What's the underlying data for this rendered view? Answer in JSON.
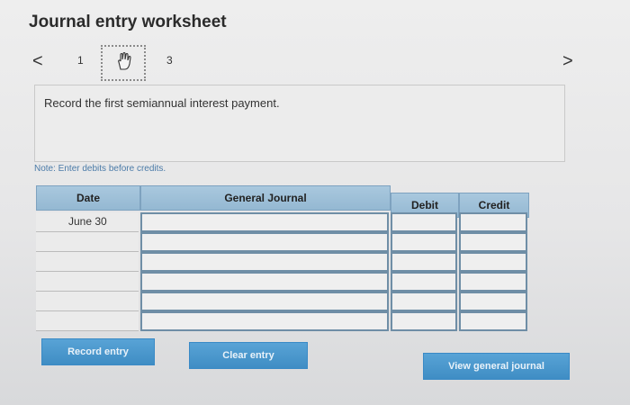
{
  "header": {
    "title": "Journal entry worksheet"
  },
  "nav": {
    "prev_icon": "<",
    "next_icon": ">",
    "steps": [
      "1",
      "",
      "3"
    ]
  },
  "prompt": {
    "text": "Record the first semiannual interest payment."
  },
  "note": {
    "text": "Note: Enter debits before credits."
  },
  "table": {
    "headers": {
      "date": "Date",
      "general_journal": "General Journal",
      "debit": "Debit",
      "credit": "Credit"
    },
    "rows": [
      {
        "date": "June 30",
        "general_journal": "",
        "debit": "",
        "credit": ""
      },
      {
        "date": "",
        "general_journal": "",
        "debit": "",
        "credit": ""
      },
      {
        "date": "",
        "general_journal": "",
        "debit": "",
        "credit": ""
      },
      {
        "date": "",
        "general_journal": "",
        "debit": "",
        "credit": ""
      },
      {
        "date": "",
        "general_journal": "",
        "debit": "",
        "credit": ""
      },
      {
        "date": "",
        "general_journal": "",
        "debit": "",
        "credit": ""
      }
    ]
  },
  "buttons": {
    "record": "Record entry",
    "clear": "Clear entry",
    "view": "View general journal"
  }
}
